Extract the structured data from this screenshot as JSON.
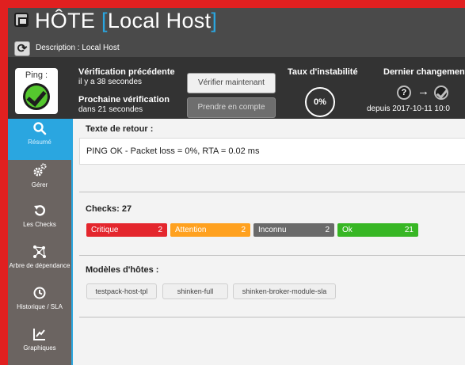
{
  "header": {
    "title_prefix": "HÔTE",
    "bracket_open": "[",
    "host_name": "Local Host",
    "bracket_close": "]",
    "refresh_icon": "refresh-icon",
    "description": "Description : Local Host"
  },
  "status": {
    "ping_label": "Ping :",
    "ping_state_icon": "ok-check-icon",
    "previous_check_title": "Vérification précédente",
    "previous_check_value": "il y a 38 secondes",
    "next_check_title": "Prochaine vérification",
    "next_check_value": "dans 21 secondes",
    "verify_now_label": "Vérifier maintenant",
    "acknowledge_label": "Prendre en compte",
    "instability_title": "Taux d'instabilité",
    "instability_value": "0%",
    "last_change_title": "Dernier changement",
    "last_change_from": "?",
    "last_change_arrow": "→",
    "last_change_since": "depuis 2017-10-11 10:0"
  },
  "sidebar": {
    "items": [
      {
        "label": "Résumé",
        "icon": "search-icon"
      },
      {
        "label": "Gérer",
        "icon": "gears-icon"
      },
      {
        "label": "Les Checks",
        "icon": "redo-icon"
      },
      {
        "label": "Arbre de dépendance",
        "icon": "tree-icon"
      },
      {
        "label": "Historique / SLA",
        "icon": "clock-icon"
      },
      {
        "label": "Graphiques",
        "icon": "chart-icon"
      }
    ]
  },
  "main": {
    "output_title": "Texte de retour :",
    "output_text": "PING OK - Packet loss = 0%, RTA = 0.02 ms",
    "checks_title": "Checks: 27",
    "checks": [
      {
        "name": "Critique",
        "count": "2",
        "color": "#e4262d"
      },
      {
        "name": "Attention",
        "count": "2",
        "color": "#ffa11f"
      },
      {
        "name": "Inconnu",
        "count": "2",
        "color": "#6a6a6a"
      },
      {
        "name": "Ok",
        "count": "21",
        "color": "#37b624"
      }
    ],
    "templates_title": "Modèles d'hôtes :",
    "templates": [
      "testpack-host-tpl",
      "shinken-full",
      "shinken-broker-module-sla"
    ]
  },
  "colors": {
    "accent": "#2aa6e0",
    "frame": "#e02020",
    "ok": "#55c82e"
  }
}
